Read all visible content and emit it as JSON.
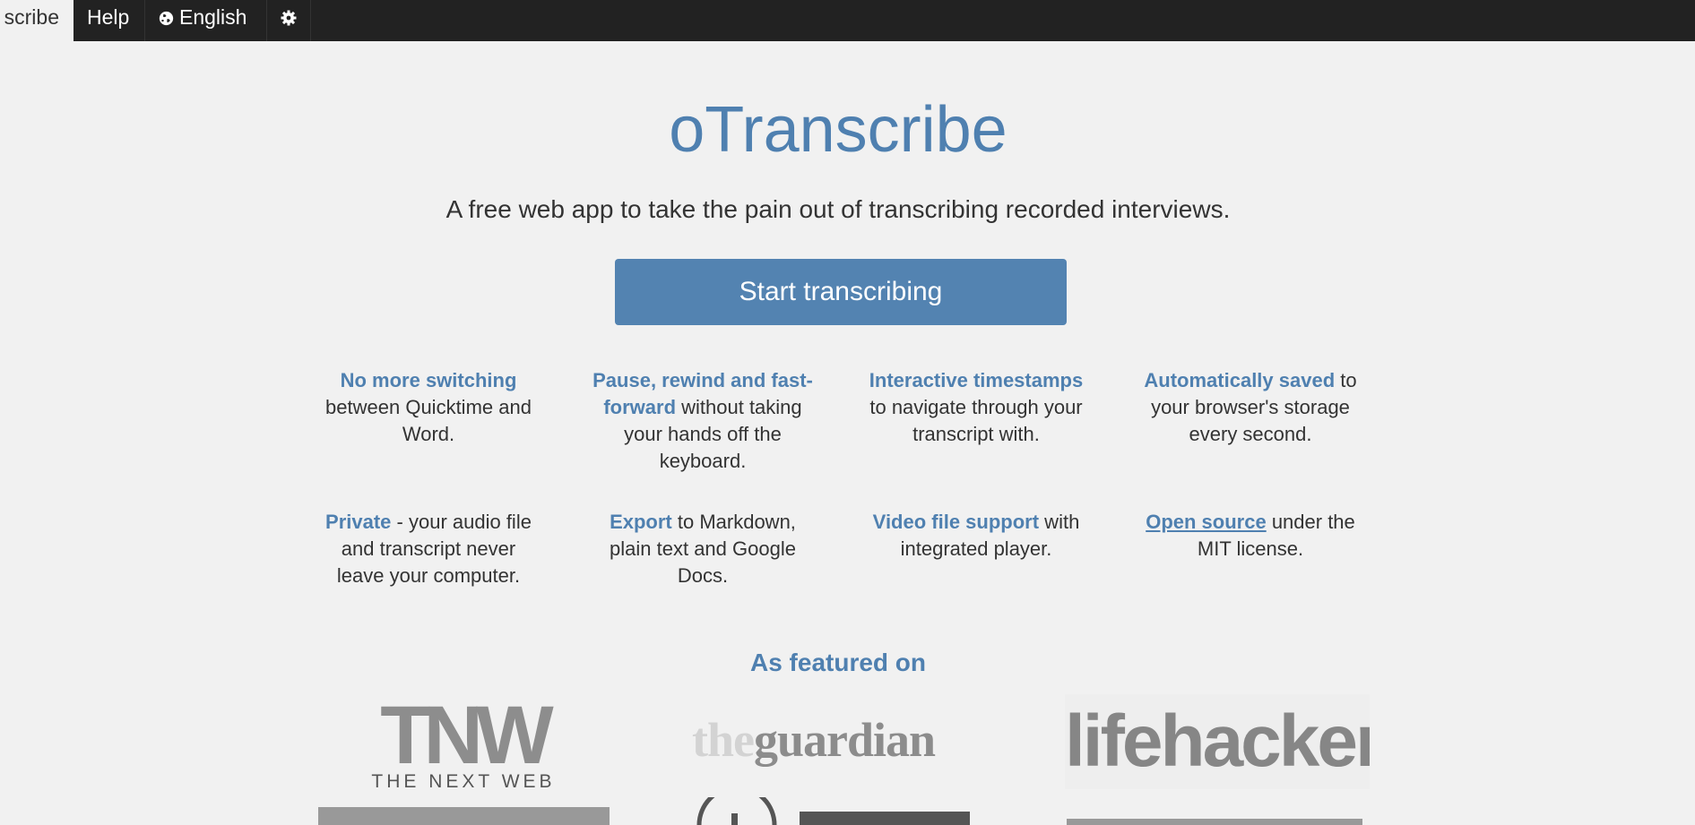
{
  "nav": {
    "tabs": [
      {
        "label": "scribe"
      },
      {
        "label": "Help"
      },
      {
        "label": "English"
      }
    ]
  },
  "hero": {
    "title": "oTranscribe",
    "tagline": "A free web app to take the pain out of transcribing recorded interviews.",
    "start_label": "Start transcribing"
  },
  "features": [
    {
      "highlight": "No more switching",
      "rest": " between Quicktime and Word."
    },
    {
      "highlight": "Pause, rewind and fast-forward",
      "rest": " without taking your hands off the keyboard."
    },
    {
      "highlight": "Interactive timestamps",
      "rest": " to navigate through your transcript with."
    },
    {
      "highlight": "Automatically saved",
      "rest": " to your browser's storage every second."
    },
    {
      "highlight": "Private",
      "rest": " - your audio file and transcript never leave your computer."
    },
    {
      "highlight": "Export",
      "rest": " to Markdown, plain text and Google Docs."
    },
    {
      "highlight": "Video file support",
      "rest": " with integrated player."
    },
    {
      "highlight": "Open source",
      "rest": " under the MIT license."
    }
  ],
  "featured": {
    "heading": "As featured on",
    "logos": {
      "tnw_big": "TNW",
      "tnw_small": "THE NEXT WEB",
      "guardian_the": "the",
      "guardian_name": "guardian",
      "lifehacker": "lifehacker"
    }
  },
  "colors": {
    "accent": "#4f80b0",
    "button": "#5383b1",
    "topbar": "#222222",
    "background": "#f1f1f1"
  },
  "icons": {
    "language": "globe-icon",
    "settings": "gear-icon"
  }
}
